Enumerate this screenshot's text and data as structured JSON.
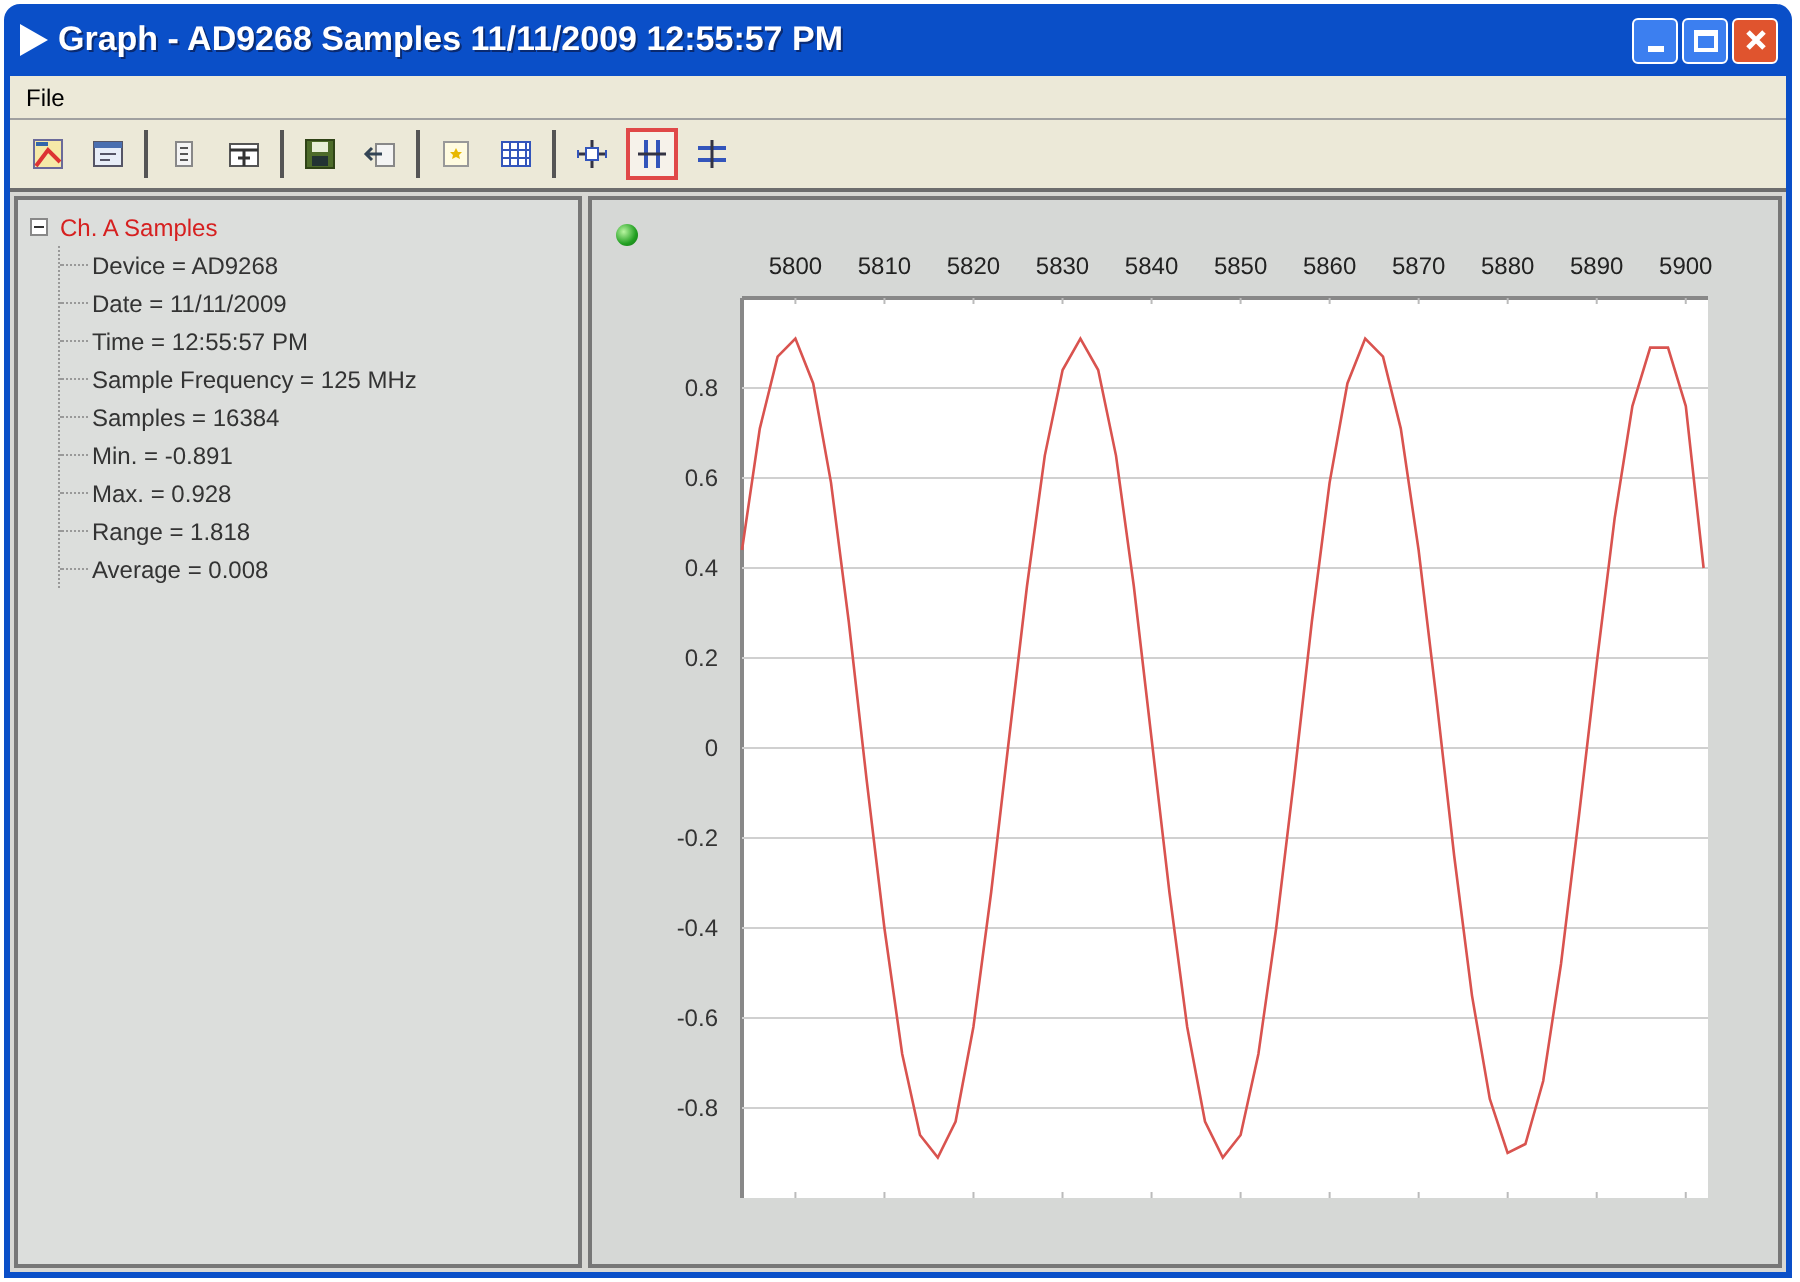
{
  "window": {
    "title": "Graph - AD9268 Samples 11/11/2009 12:55:57 PM"
  },
  "menu": [
    "File"
  ],
  "toolbar": {
    "groups": [
      {
        "buttons": [
          {
            "selected": false
          },
          {
            "selected": false
          }
        ]
      },
      {
        "buttons": [
          {
            "selected": false
          },
          {
            "selected": false
          }
        ]
      },
      {
        "buttons": [
          {
            "selected": false
          },
          {
            "selected": false
          }
        ]
      },
      {
        "buttons": [
          {
            "selected": false
          },
          {
            "selected": false
          }
        ]
      },
      {
        "buttons": [
          {
            "selected": false
          },
          {
            "selected": true
          },
          {
            "selected": false
          }
        ]
      }
    ]
  },
  "tree": [
    {
      "label": "Ch. A Samples",
      "expanded": true,
      "children": [
        {
          "label": "Device = AD9268"
        },
        {
          "label": "Date = 11/11/2009"
        },
        {
          "label": "Time = 12:55:57 PM"
        },
        {
          "label": "Sample Frequency = 125 MHz"
        },
        {
          "label": "Samples = 16384"
        },
        {
          "label": "Min. = -0.891"
        },
        {
          "label": "Max. = 0.928"
        },
        {
          "label": "Range = 1.818"
        },
        {
          "label": "Average = 0.008"
        }
      ]
    }
  ],
  "graph": {
    "chart_data": {
      "type": "line",
      "x": [
        5794,
        5796,
        5798,
        5800,
        5802,
        5804,
        5806,
        5808,
        5810,
        5812,
        5814,
        5816,
        5818,
        5820,
        5822,
        5824,
        5826,
        5828,
        5830,
        5832,
        5834,
        5836,
        5838,
        5840,
        5842,
        5844,
        5846,
        5848,
        5850,
        5852,
        5854,
        5856,
        5858,
        5860,
        5862,
        5864,
        5866,
        5868,
        5870,
        5872,
        5874,
        5876,
        5878,
        5880,
        5882,
        5884,
        5886,
        5888,
        5890,
        5892,
        5894,
        5896,
        5898,
        5900,
        5902
      ],
      "series": [
        {
          "color": "#d9534f",
          "values": [
            0.44,
            0.71,
            0.87,
            0.91,
            0.81,
            0.59,
            0.28,
            -0.07,
            -0.4,
            -0.68,
            -0.86,
            -0.91,
            -0.83,
            -0.62,
            -0.32,
            0.02,
            0.36,
            0.65,
            0.84,
            0.91,
            0.84,
            0.65,
            0.36,
            0.02,
            -0.32,
            -0.62,
            -0.83,
            -0.91,
            -0.86,
            -0.68,
            -0.4,
            -0.07,
            0.28,
            0.59,
            0.81,
            0.91,
            0.87,
            0.71,
            0.44,
            0.11,
            -0.24,
            -0.55,
            -0.78,
            -0.9,
            -0.88,
            -0.74,
            -0.48,
            -0.15,
            0.19,
            0.51,
            0.76,
            0.89,
            0.89,
            0.76,
            0.4
          ]
        }
      ],
      "grid": true,
      "xlim": [
        5794,
        5902.5
      ],
      "ylim": [
        -1,
        1
      ],
      "xticks": [
        5800,
        5810,
        5820,
        5830,
        5840,
        5850,
        5860,
        5870,
        5880,
        5890,
        5900
      ],
      "yticks": [
        0.8,
        0.6,
        0.4,
        0.2,
        0,
        -0.2,
        -0.4,
        -0.6,
        -0.8
      ]
    }
  }
}
